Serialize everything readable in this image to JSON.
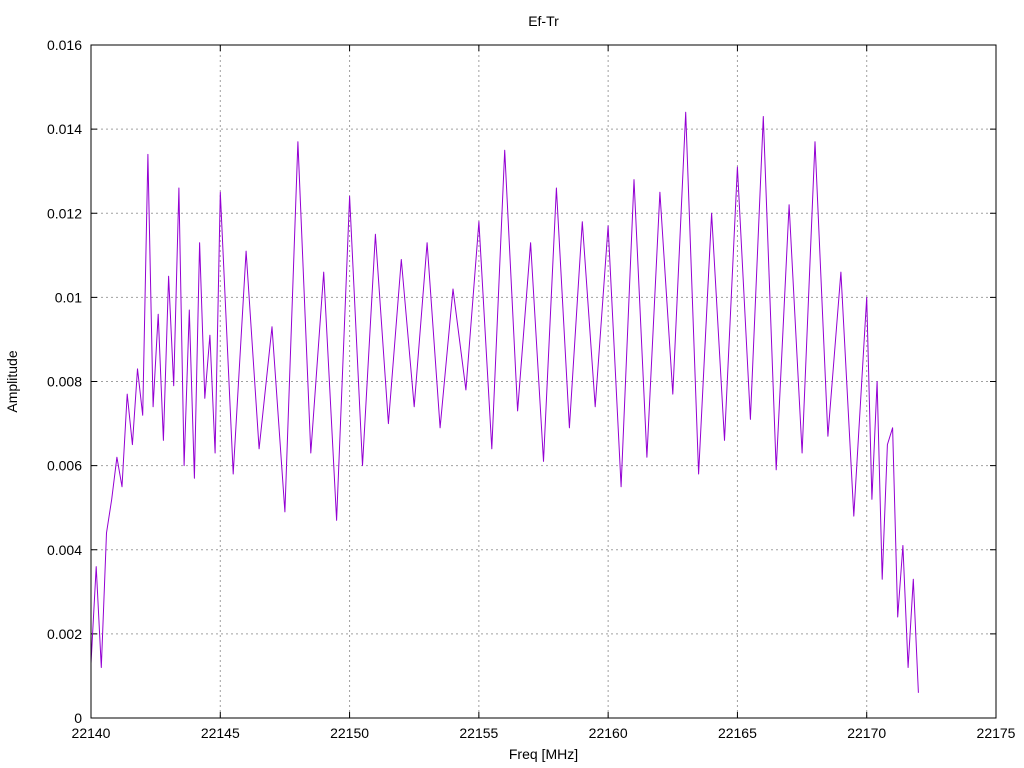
{
  "chart_data": {
    "type": "line",
    "title": "Ef-Tr",
    "xlabel": "Freq [MHz]",
    "ylabel": "Amplitude",
    "xlim": [
      22140,
      22175
    ],
    "ylim": [
      0,
      0.016
    ],
    "xticks": [
      "22140",
      "22145",
      "22150",
      "22155",
      "22160",
      "22165",
      "22170",
      "22175"
    ],
    "yticks": [
      "0",
      "0.002",
      "0.004",
      "0.006",
      "0.008",
      "0.01",
      "0.012",
      "0.014",
      "0.016"
    ],
    "grid": true,
    "legend": "none",
    "series": [
      {
        "color": "#9400d3",
        "x": [
          22140.0,
          22140.2,
          22140.4,
          22140.6,
          22140.8,
          22141.0,
          22141.2,
          22141.4,
          22141.6,
          22141.8,
          22142.0,
          22142.2,
          22142.4,
          22142.6,
          22142.8,
          22143.0,
          22143.2,
          22143.4,
          22143.6,
          22143.8,
          22144.0,
          22144.2,
          22144.4,
          22144.6,
          22144.8,
          22145.0,
          22145.5,
          22146.0,
          22146.5,
          22147.0,
          22147.5,
          22148.0,
          22148.5,
          22149.0,
          22149.5,
          22150.0,
          22150.5,
          22151.0,
          22151.5,
          22152.0,
          22152.5,
          22153.0,
          22153.5,
          22154.0,
          22154.5,
          22155.0,
          22155.5,
          22156.0,
          22156.5,
          22157.0,
          22157.5,
          22158.0,
          22158.5,
          22159.0,
          22159.5,
          22160.0,
          22160.5,
          22161.0,
          22161.5,
          22162.0,
          22162.5,
          22163.0,
          22163.5,
          22164.0,
          22164.5,
          22165.0,
          22165.5,
          22166.0,
          22166.5,
          22167.0,
          22167.5,
          22168.0,
          22168.5,
          22169.0,
          22169.5,
          22170.0,
          22170.2,
          22170.4,
          22170.6,
          22170.8,
          22171.0,
          22171.2,
          22171.4,
          22171.6,
          22171.8,
          22172.0
        ],
        "y": [
          0.0013,
          0.0036,
          0.0012,
          0.0044,
          0.0052,
          0.0062,
          0.0055,
          0.0077,
          0.0065,
          0.0083,
          0.0072,
          0.0134,
          0.0074,
          0.0096,
          0.0066,
          0.0105,
          0.0079,
          0.0126,
          0.006,
          0.0097,
          0.0057,
          0.0113,
          0.0076,
          0.0091,
          0.0063,
          0.0125,
          0.0058,
          0.0111,
          0.0064,
          0.0093,
          0.0049,
          0.0137,
          0.0063,
          0.0106,
          0.0047,
          0.0124,
          0.006,
          0.0115,
          0.007,
          0.0109,
          0.0074,
          0.0113,
          0.0069,
          0.0102,
          0.0078,
          0.0118,
          0.0064,
          0.0135,
          0.0073,
          0.0113,
          0.0061,
          0.0126,
          0.0069,
          0.0118,
          0.0074,
          0.0117,
          0.0055,
          0.0128,
          0.0062,
          0.0125,
          0.0077,
          0.0144,
          0.0058,
          0.012,
          0.0066,
          0.0131,
          0.0071,
          0.0143,
          0.0059,
          0.0122,
          0.0063,
          0.0137,
          0.0067,
          0.0106,
          0.0048,
          0.01,
          0.0052,
          0.008,
          0.0033,
          0.0065,
          0.0069,
          0.0024,
          0.0041,
          0.0012,
          0.0033,
          0.0006
        ]
      }
    ]
  }
}
